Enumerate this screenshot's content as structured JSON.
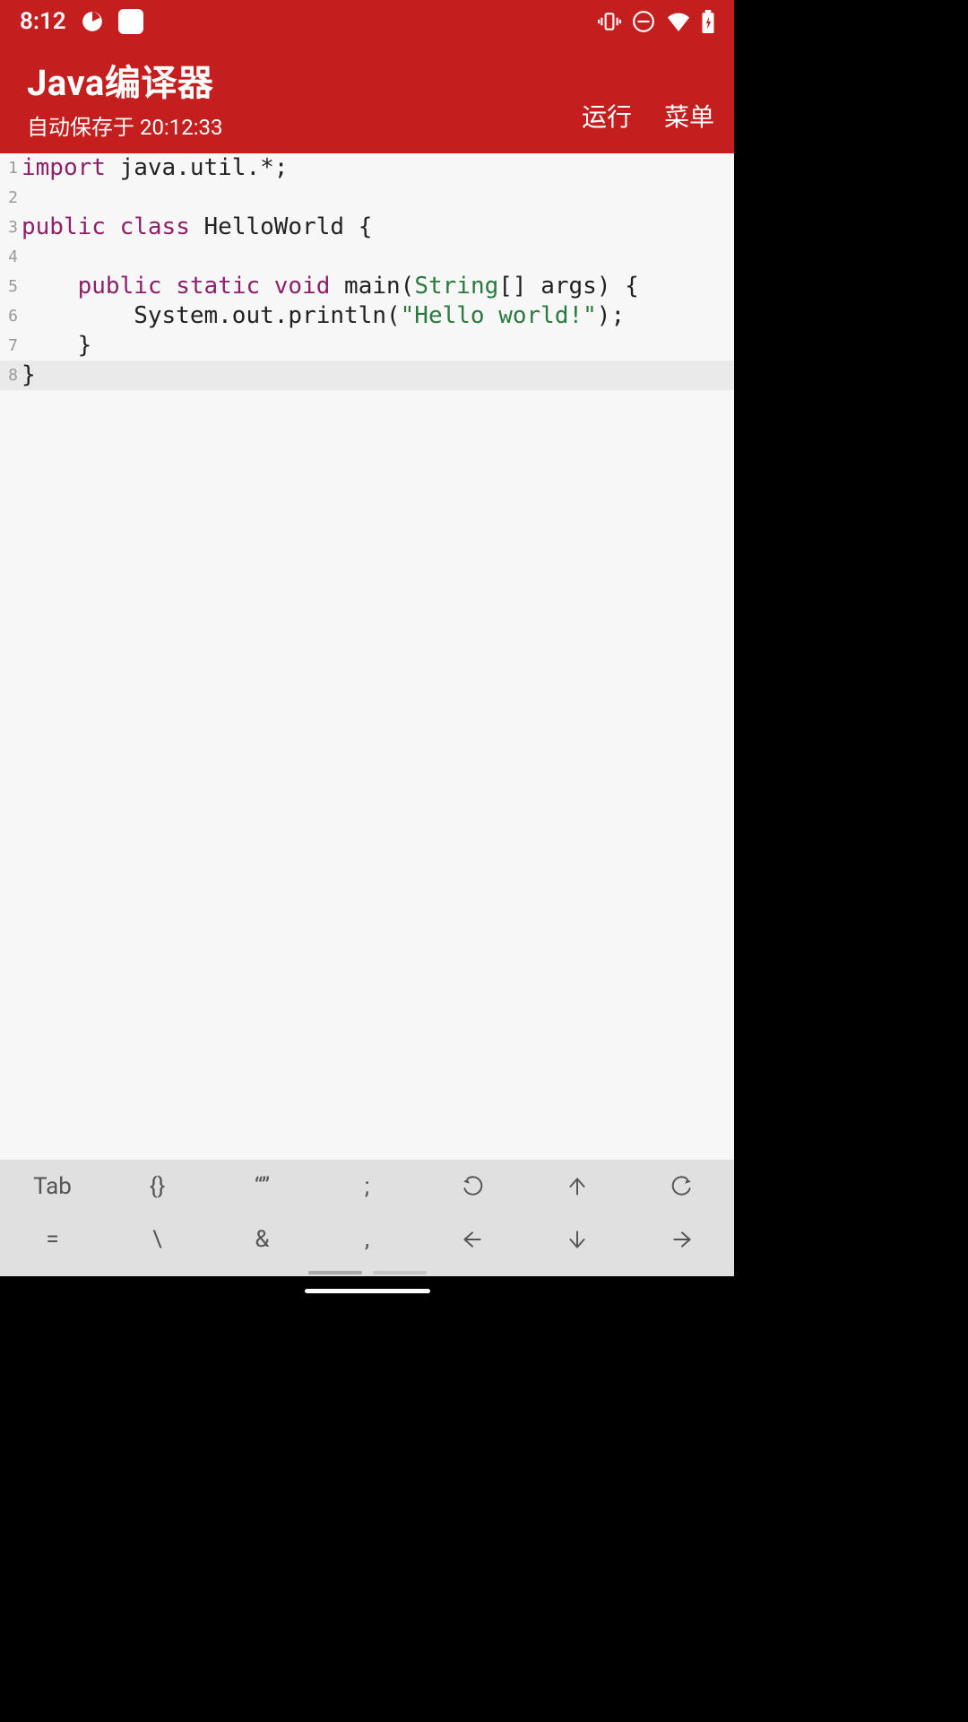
{
  "status": {
    "time": "8:12"
  },
  "header": {
    "title": "Java编译器",
    "subtitle": "自动保存于 20:12:33",
    "run_label": "运行",
    "menu_label": "菜单"
  },
  "code": {
    "current_line": 8,
    "lines": [
      {
        "n": 1,
        "tokens": [
          [
            "kw",
            "import"
          ],
          [
            "",
            " java.util.*;"
          ]
        ]
      },
      {
        "n": 2,
        "tokens": [
          [
            "",
            ""
          ]
        ]
      },
      {
        "n": 3,
        "tokens": [
          [
            "kw",
            "public"
          ],
          [
            "",
            " "
          ],
          [
            "kw",
            "class"
          ],
          [
            "",
            " HelloWorld {"
          ]
        ]
      },
      {
        "n": 4,
        "tokens": [
          [
            "",
            ""
          ]
        ]
      },
      {
        "n": 5,
        "tokens": [
          [
            "",
            "    "
          ],
          [
            "kw",
            "public"
          ],
          [
            "",
            " "
          ],
          [
            "kw",
            "static"
          ],
          [
            "",
            " "
          ],
          [
            "kw",
            "void"
          ],
          [
            "",
            " main("
          ],
          [
            "ty",
            "String"
          ],
          [
            "",
            "[] args) {"
          ]
        ]
      },
      {
        "n": 6,
        "tokens": [
          [
            "",
            "        System.out.println("
          ],
          [
            "st",
            "\"Hello world!\""
          ],
          [
            "",
            ");"
          ]
        ]
      },
      {
        "n": 7,
        "tokens": [
          [
            "",
            "    }"
          ]
        ]
      },
      {
        "n": 8,
        "tokens": [
          [
            "",
            "}"
          ]
        ]
      }
    ]
  },
  "toolbar": {
    "row1": [
      "Tab",
      "{}",
      "“”",
      ";",
      "undo-icon",
      "arrow-up-icon",
      "redo-icon"
    ],
    "row2": [
      "=",
      "\\",
      "&",
      ",",
      "arrow-left-icon",
      "arrow-down-icon",
      "arrow-right-icon"
    ]
  }
}
